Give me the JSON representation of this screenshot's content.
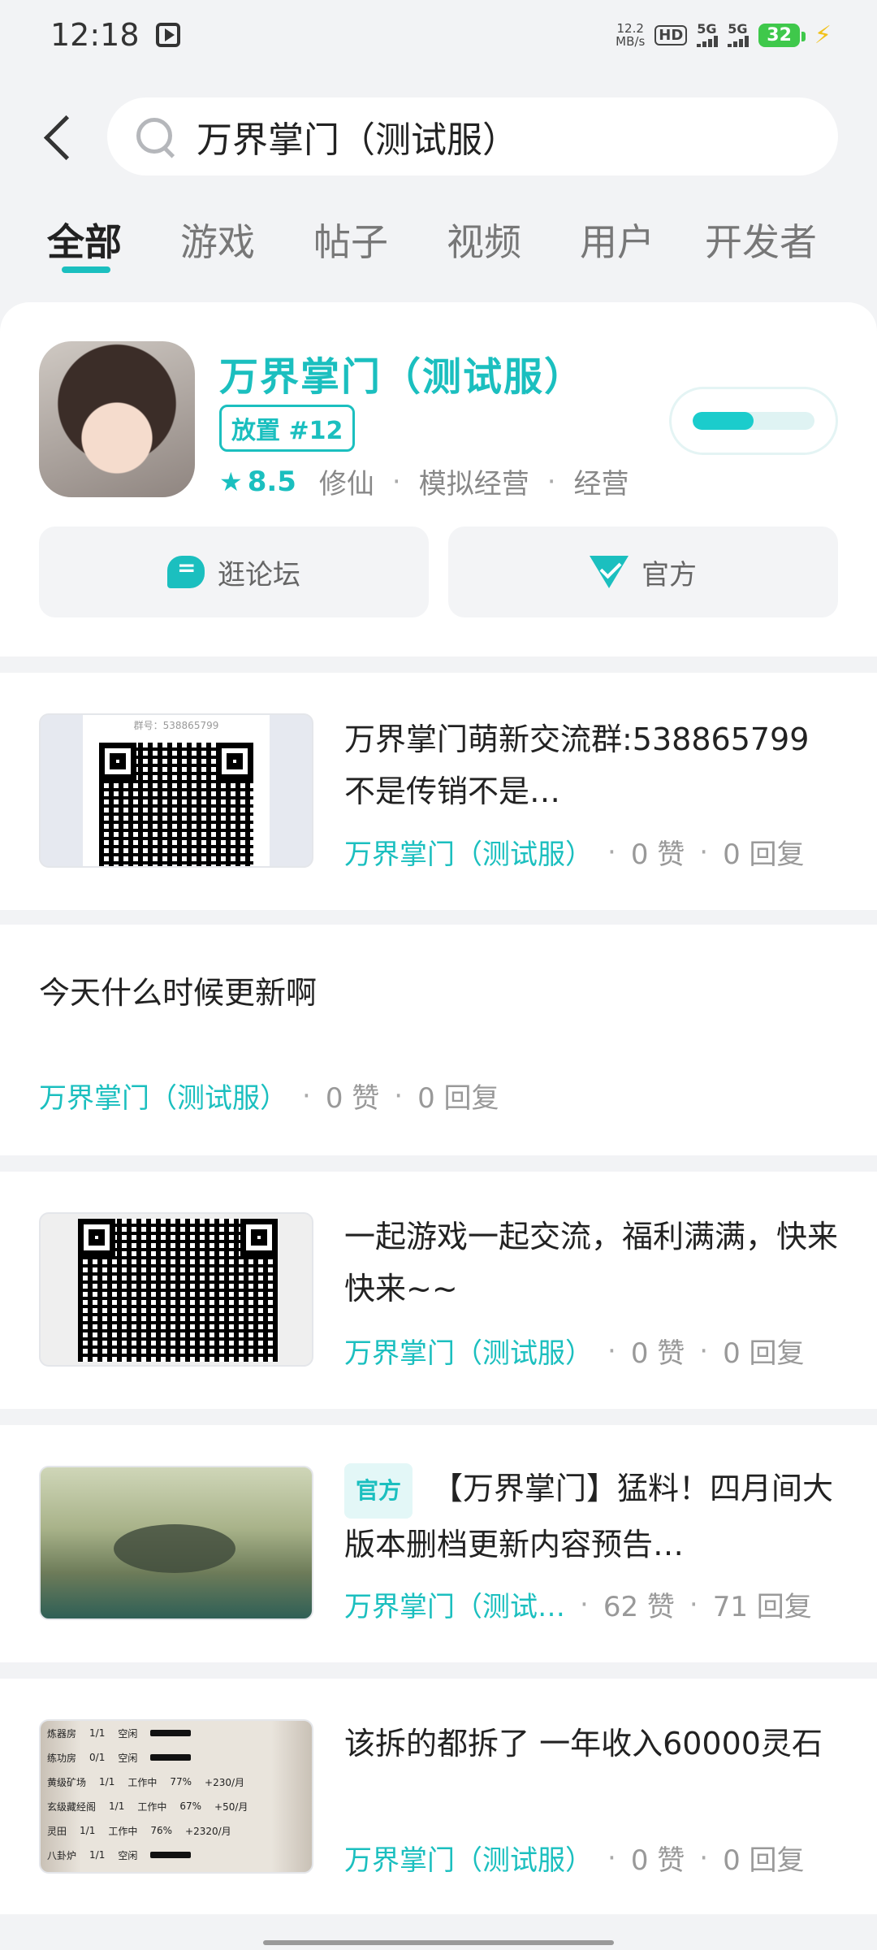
{
  "status_bar": {
    "time": "12:18",
    "speed_value": "12.2",
    "speed_unit": "MB/s",
    "hd": "HD",
    "sim1": "5G",
    "sim2": "5G",
    "battery": "32"
  },
  "search": {
    "query": "万界掌门（测试服）"
  },
  "tabs": [
    "全部",
    "游戏",
    "帖子",
    "视频",
    "用户",
    "开发者"
  ],
  "active_tab": "全部",
  "game": {
    "title": "万界掌门（测试服）",
    "rank_badge": "放置 #12",
    "rating": "8.5",
    "tags": [
      "修仙",
      "模拟经营",
      "经营"
    ],
    "download_progress": 0.5,
    "forum_button": "逛论坛",
    "official_button": "官方"
  },
  "posts": [
    {
      "title": "万界掌门萌新交流群:538865799 不是传销不是…",
      "game": "万界掌门（测试服）",
      "likes": "0 赞",
      "replies": "0 回复",
      "thumb_text": "群号：538865799"
    },
    {
      "title": "今天什么时候更新啊",
      "game": "万界掌门（测试服）",
      "likes": "0 赞",
      "replies": "0 回复"
    },
    {
      "title": "一起游戏一起交流，福利满满，快来快来~~",
      "game": "万界掌门（测试服）",
      "likes": "0 赞",
      "replies": "0 回复"
    },
    {
      "tag": "官方",
      "title": "【万界掌门】猛料！四月间大版本删档更新内容预告…",
      "game": "万界掌门（测试…",
      "likes": "62 赞",
      "replies": "71 回复"
    },
    {
      "title": "该拆的都拆了  一年收入60000灵石",
      "game": "万界掌门（测试服）",
      "likes": "0 赞",
      "replies": "0 回复",
      "thumb_rows": [
        {
          "name": "炼器房",
          "count": "1/1",
          "state": "空闲"
        },
        {
          "name": "练功房",
          "count": "0/1",
          "state": "空闲"
        },
        {
          "name": "黄级矿场",
          "count": "1/1",
          "state": "工作中",
          "pct": "77%",
          "yield": "+230/月"
        },
        {
          "name": "玄级藏经阁",
          "count": "1/1",
          "state": "工作中",
          "pct": "67%",
          "yield": "+50/月"
        },
        {
          "name": "灵田",
          "count": "1/1",
          "state": "工作中",
          "pct": "76%",
          "yield": "+2320/月"
        },
        {
          "name": "八卦炉",
          "count": "1/1",
          "state": "空闲"
        }
      ]
    }
  ],
  "colors": {
    "accent": "#1bbfbf",
    "background": "#f2f3f5"
  }
}
